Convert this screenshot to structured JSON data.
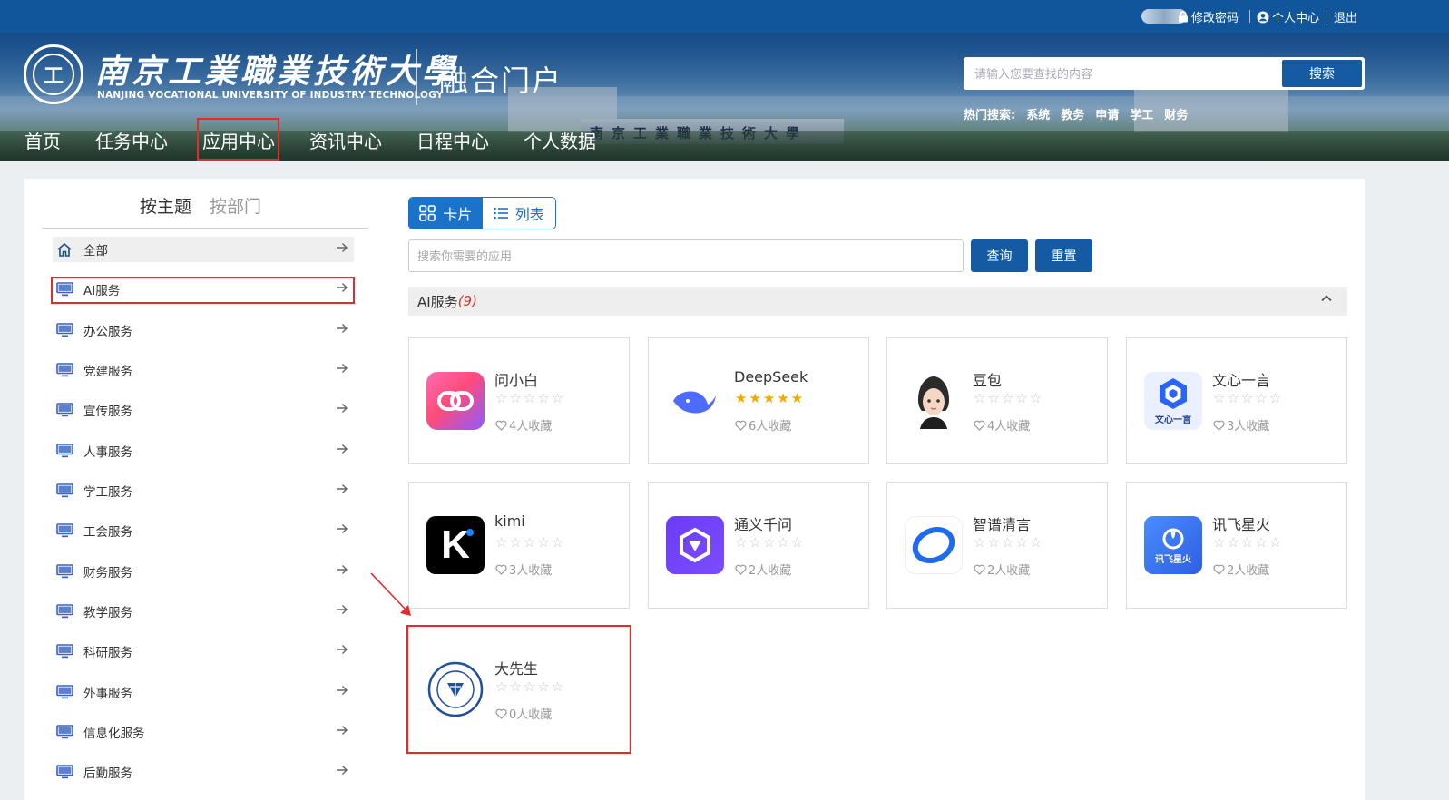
{
  "topbar": {
    "change_password": "修改密码",
    "personal_center": "个人中心",
    "logout": "退出"
  },
  "header": {
    "school_cn": "南京工業職業技術大學",
    "school_en": "NANJING VOCATIONAL UNIVERSITY OF INDUSTRY TECHNOLOGY",
    "emblem_char": "工",
    "portal_title": "融合门户",
    "gate_text": "南京工業職業技術大學",
    "search_placeholder": "请输入您要查找的内容",
    "search_button": "搜索",
    "hot_label": "热门搜索:",
    "hot_terms": [
      "系统",
      "教务",
      "申请",
      "学工",
      "财务"
    ]
  },
  "nav": [
    "首页",
    "任务中心",
    "应用中心",
    "资讯中心",
    "日程中心",
    "个人数据"
  ],
  "sidebar": {
    "tab_theme": "按主题",
    "tab_dept": "按部门",
    "items": [
      "全部",
      "AI服务",
      "办公服务",
      "党建服务",
      "宣传服务",
      "人事服务",
      "学工服务",
      "工会服务",
      "财务服务",
      "教学服务",
      "科研服务",
      "外事服务",
      "信息化服务",
      "后勤服务"
    ]
  },
  "view": {
    "card": "卡片",
    "list": "列表"
  },
  "app_search": {
    "placeholder": "搜索你需要的应用",
    "query_button": "查询",
    "reset_button": "重置"
  },
  "section": {
    "title": "AI服务",
    "count": "(9)"
  },
  "apps": [
    {
      "name": "问小白",
      "stars": 0,
      "favorites": "4人收藏",
      "icon": "wenxiaobai-icon"
    },
    {
      "name": "DeepSeek",
      "stars": 5,
      "favorites": "6人收藏",
      "icon": "deepseek-whale-icon"
    },
    {
      "name": "豆包",
      "stars": 0,
      "favorites": "4人收藏",
      "icon": "doubao-avatar-icon"
    },
    {
      "name": "文心一言",
      "stars": 0,
      "favorites": "3人收藏",
      "icon": "wenxin-icon",
      "logo_text": "文心一言"
    },
    {
      "name": "kimi",
      "stars": 0,
      "favorites": "3人收藏",
      "icon": "kimi-icon",
      "logo_text": "K"
    },
    {
      "name": "通义千问",
      "stars": 0,
      "favorites": "2人收藏",
      "icon": "tongyi-icon"
    },
    {
      "name": "智谱清言",
      "stars": 0,
      "favorites": "2人收藏",
      "icon": "zhipu-icon"
    },
    {
      "name": "讯飞星火",
      "stars": 0,
      "favorites": "2人收藏",
      "icon": "xunfei-icon",
      "logo_text": "讯飞星火"
    },
    {
      "name": "大先生",
      "stars": 0,
      "favorites": "0人收藏",
      "icon": "zju-emblem-icon"
    }
  ],
  "colors": {
    "primary": "#155ba3",
    "highlight": "#e22b2b",
    "star_gold": "#f3a800"
  }
}
